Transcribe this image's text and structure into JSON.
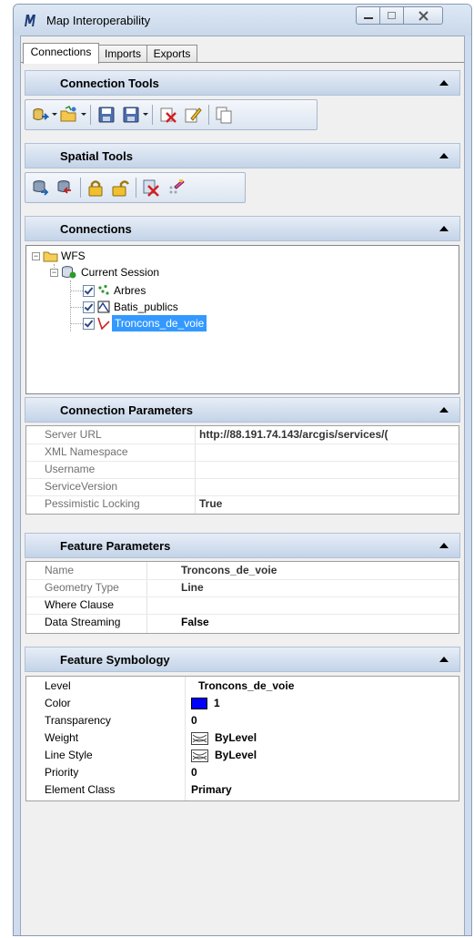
{
  "window": {
    "title": "Map Interoperability"
  },
  "tabs": [
    {
      "label": "Connections",
      "active": true
    },
    {
      "label": "Imports",
      "active": false
    },
    {
      "label": "Exports",
      "active": false
    }
  ],
  "panels": {
    "connection_tools": "Connection Tools",
    "spatial_tools": "Spatial Tools",
    "connections": "Connections",
    "connection_parameters": "Connection Parameters",
    "feature_parameters": "Feature Parameters",
    "feature_symbology": "Feature Symbology"
  },
  "tree": {
    "root": "WFS",
    "session": "Current Session",
    "layers": [
      {
        "label": "Arbres",
        "checked": true,
        "selected": false
      },
      {
        "label": "Batis_publics",
        "checked": true,
        "selected": false
      },
      {
        "label": "Troncons_de_voie",
        "checked": true,
        "selected": true
      }
    ]
  },
  "connection_parameters": [
    {
      "label": "Server URL",
      "value": "http://88.191.74.143/arcgis/services/("
    },
    {
      "label": "XML Namespace",
      "value": ""
    },
    {
      "label": "Username",
      "value": ""
    },
    {
      "label": "ServiceVersion",
      "value": ""
    },
    {
      "label": "Pessimistic Locking",
      "value": "True"
    }
  ],
  "feature_parameters": [
    {
      "label": "Name",
      "value": "Troncons_de_voie"
    },
    {
      "label": "Geometry Type",
      "value": "Line"
    },
    {
      "label": "Where Clause",
      "value": ""
    },
    {
      "label": "Data Streaming",
      "value": "False"
    }
  ],
  "feature_symbology": [
    {
      "label": "Level",
      "value": "Troncons_de_voie"
    },
    {
      "label": "Color",
      "value": "1"
    },
    {
      "label": "Transparency",
      "value": "0"
    },
    {
      "label": "Weight",
      "value": "ByLevel"
    },
    {
      "label": "Line Style",
      "value": "ByLevel"
    },
    {
      "label": "Priority",
      "value": "0"
    },
    {
      "label": "Element Class",
      "value": "Primary"
    }
  ],
  "colors": {
    "selection": "#3399ff",
    "color_swatch": "#0000ff",
    "header_gradient_bottom": "#c3d3e8"
  }
}
